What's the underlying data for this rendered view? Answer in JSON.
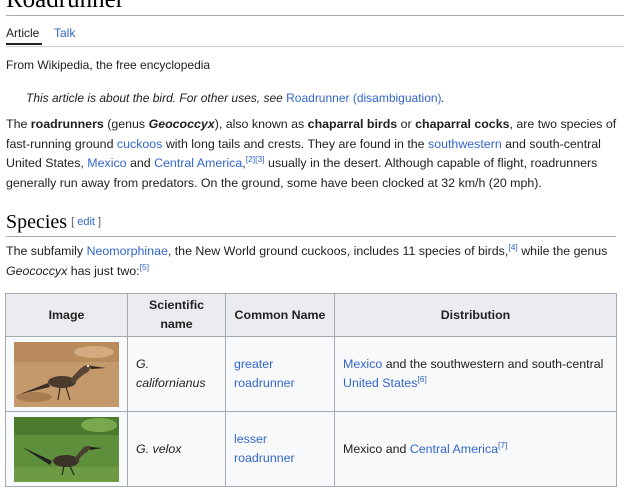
{
  "page": {
    "title": "Roadrunner",
    "tabs": [
      {
        "label": "Article",
        "selected": true
      },
      {
        "label": "Talk",
        "selected": false
      }
    ],
    "tagline": "From Wikipedia, the free encyclopedia"
  },
  "hatnote": {
    "text": "This article is about the bird. For other uses, see ",
    "link": "Roadrunner (disambiguation)",
    "end": "."
  },
  "intro": {
    "t1": "The ",
    "b1": "roadrunners",
    "t2": " (genus ",
    "b2": "Geococcyx",
    "t3": "), also known as ",
    "b3": "chaparral birds",
    "t4": " or ",
    "b4": "chaparral cocks",
    "t5": ", are two species of fast-running ground ",
    "l1": "cuckoos",
    "t6": " with long tails and crests. They are found in the ",
    "l2": "southwestern",
    "t7": " and south-central United States, ",
    "l3": "Mexico",
    "t8": " and ",
    "l4": "Central America",
    "t9": ",",
    "ref1": "[2]",
    "ref2": "[3]",
    "t10": " usually in the desert. Although capable of flight, roadrunners generally run away from predators. On the ground, some have been clocked at 32 km/h (20 mph)."
  },
  "species_section": {
    "heading": "Species",
    "edit_open": "[ ",
    "edit_label": "edit",
    "edit_close": " ]",
    "t1": "The subfamily ",
    "l1": "Neomorphinae",
    "t2": ", the New World ground cuckoos, includes 11 species of birds,",
    "ref1": "[4]",
    "t3": " while the genus ",
    "i1": "Geococcyx",
    "t4": " has just two:",
    "ref2": "[5]"
  },
  "table": {
    "headers": {
      "image": "Image",
      "scientific": "Scientific name",
      "common": "Common Name",
      "distribution": "Distribution"
    },
    "rows": [
      {
        "scientific": "G. californianus",
        "common": "greater roadrunner",
        "dist_link": "Mexico",
        "dist_text": " and the southwestern and south-central ",
        "dist_link2": "United States",
        "dist_ref": "[6]"
      },
      {
        "scientific": "G. velox",
        "common": "lesser roadrunner",
        "dist_text": "Mexico and ",
        "dist_link": "Central America",
        "dist_ref": "[7]"
      }
    ]
  },
  "colors": {
    "link": "#3366cc",
    "text": "#202122",
    "header_bg": "#eaecf0",
    "border": "#a2a9b1"
  }
}
